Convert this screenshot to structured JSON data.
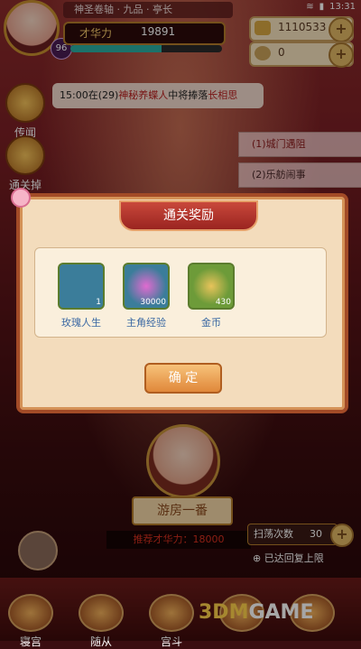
{
  "status": {
    "time": "13:31"
  },
  "player": {
    "level": "96",
    "name": "神圣卷轴 · 九品 · 亭长",
    "power_label": "才华力",
    "power_value": "19891",
    "exp_fraction": 0.6
  },
  "currency": [
    {
      "icon": "ingot-icon",
      "value": "1110533"
    },
    {
      "icon": "coin-icon",
      "value": "0"
    }
  ],
  "side": [
    {
      "label": "传闻",
      "icon": "trumpet-icon"
    },
    {
      "label": "通关掉落",
      "icon": "drop-icon"
    }
  ],
  "notice": {
    "prefix": "15:00在",
    "num": "(29)",
    "red1": "神秘养蝶人",
    "mid": "中将捧落",
    "red2": "长相思"
  },
  "right_buttons": [
    "(1)城门遇阻",
    "(2)乐舫闹事"
  ],
  "dialog": {
    "title": "通关奖励",
    "rewards": [
      {
        "label": "玫瑰人生",
        "count": "1",
        "color": "#3b7d9a"
      },
      {
        "label": "主角经验",
        "count": "30000",
        "color": "#3b7d9a"
      },
      {
        "label": "金币",
        "count": "430",
        "color": "#6d9b39"
      }
    ],
    "confirm": "确 定"
  },
  "bottom": {
    "action": "游房一番",
    "cost": "推荐才华力：18000",
    "sweep_label": "扫荡次数",
    "sweep_count": "30",
    "reset_text": "已达回复上限",
    "tabs": [
      "寝宫",
      "随从",
      "宫斗",
      "",
      ""
    ]
  },
  "watermark": {
    "a": "3DM",
    "b": "GAME"
  }
}
